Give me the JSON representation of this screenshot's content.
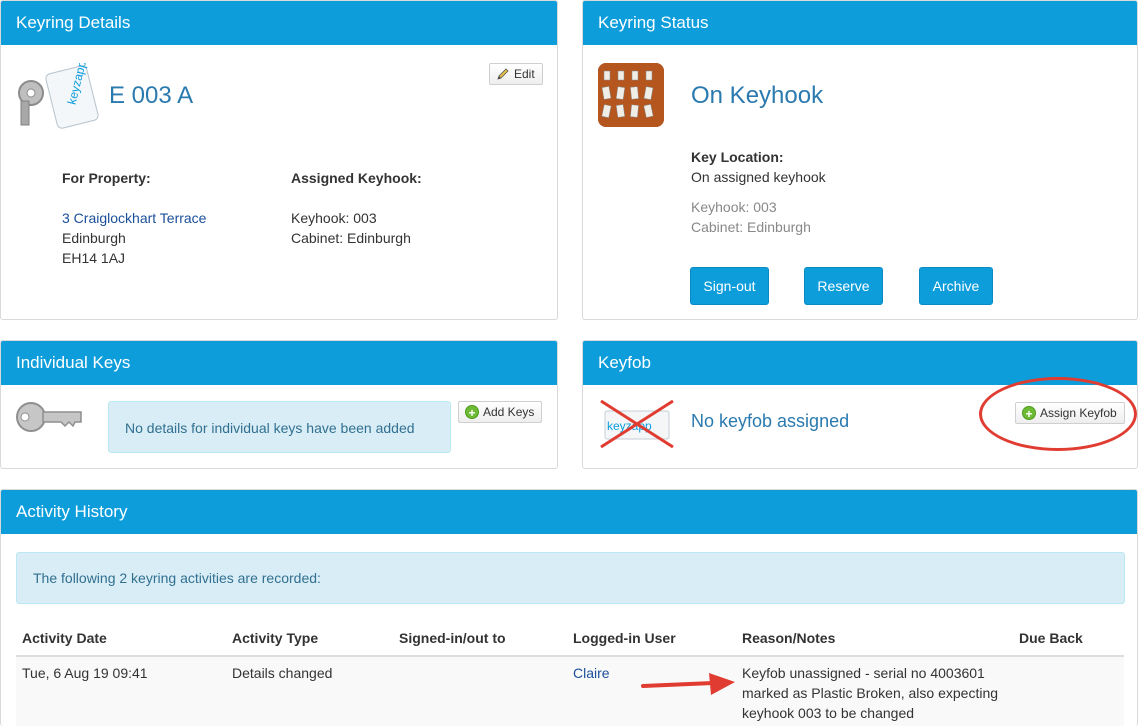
{
  "keyring_details": {
    "title": "Keyring Details",
    "edit_label": "Edit",
    "keyring_id": "E 003 A",
    "for_property_label": "For Property:",
    "property_street": "3 Craiglockhart Terrace",
    "property_city": "Edinburgh",
    "property_postcode": "EH14 1AJ",
    "assigned_keyhook_label": "Assigned Keyhook:",
    "keyhook": "Keyhook: 003",
    "cabinet": "Cabinet: Edinburgh",
    "fob_brand": "keyzapp"
  },
  "keyring_status": {
    "title": "Keyring Status",
    "status": "On Keyhook",
    "key_location_label": "Key Location:",
    "key_location": "On assigned keyhook",
    "keyhook": "Keyhook: 003",
    "cabinet": "Cabinet: Edinburgh",
    "buttons": {
      "signout": "Sign-out",
      "reserve": "Reserve",
      "archive": "Archive"
    }
  },
  "individual_keys": {
    "title": "Individual Keys",
    "message": "No details for individual keys have been added",
    "add_label": "Add Keys"
  },
  "keyfob": {
    "title": "Keyfob",
    "message": "No keyfob assigned",
    "assign_label": "Assign Keyfob",
    "fob_brand": "keyzapp"
  },
  "activity_history": {
    "title": "Activity History",
    "summary": "The following 2 keyring activities are recorded:",
    "columns": [
      "Activity Date",
      "Activity Type",
      "Signed-in/out to",
      "Logged-in User",
      "Reason/Notes",
      "Due Back"
    ],
    "rows": [
      {
        "date": "Tue, 6 Aug 19 09:41",
        "type": "Details changed",
        "signed": "",
        "user": "Claire",
        "notes": "Keyfob unassigned - serial no 4003601 marked as Plastic Broken, also expecting keyhook 003 to be changed",
        "due": ""
      }
    ]
  },
  "colors": {
    "header_blue": "#0d9ddb",
    "info_bg": "#d9edf7",
    "info_text": "#31708f",
    "annotation_red": "#e03c31"
  }
}
